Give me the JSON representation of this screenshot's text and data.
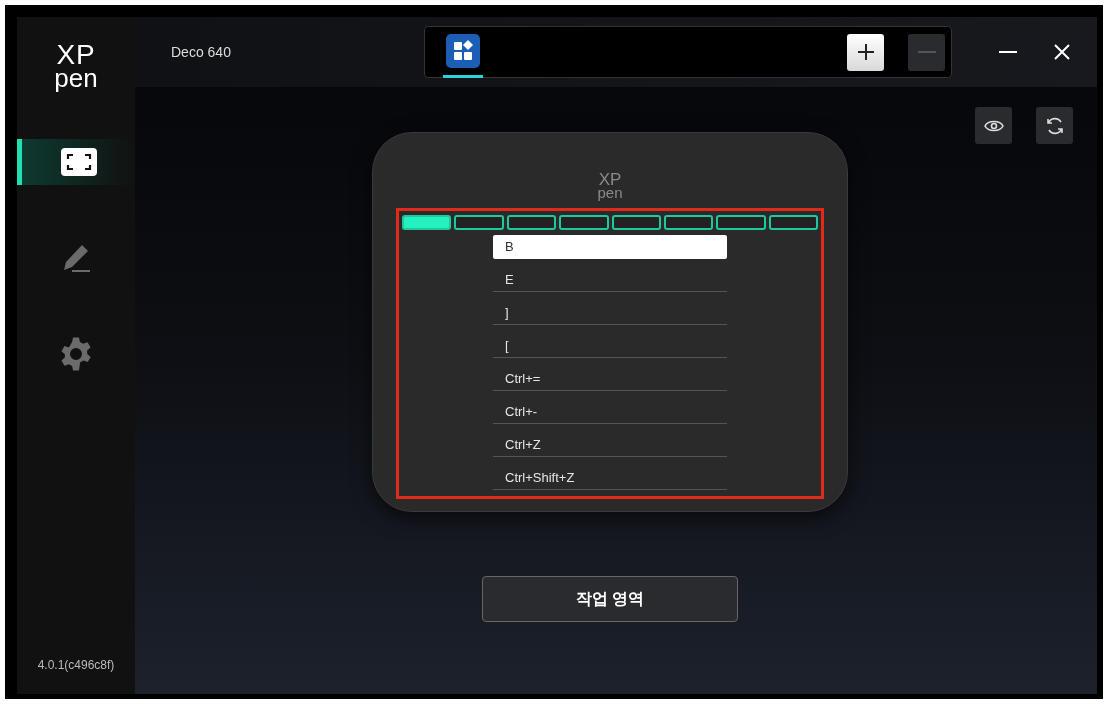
{
  "app": {
    "logo_top": "XP",
    "logo_bottom": "pen",
    "version": "4.0.1(c496c8f)"
  },
  "sidebar": {
    "items": [
      {
        "kind": "area",
        "selected": true
      },
      {
        "kind": "pen",
        "selected": false
      },
      {
        "kind": "settings",
        "selected": false
      }
    ]
  },
  "device": {
    "name": "Deco 640"
  },
  "profiles": [
    {
      "selected": true
    }
  ],
  "tablet": {
    "logo_top": "XP",
    "logo_bottom": "pen",
    "keys": [
      {
        "selected": true
      },
      {
        "selected": false
      },
      {
        "selected": false
      },
      {
        "selected": false
      },
      {
        "selected": false
      },
      {
        "selected": false
      },
      {
        "selected": false
      },
      {
        "selected": false
      }
    ],
    "shortcuts": [
      {
        "value": "B",
        "selected": true
      },
      {
        "value": "E",
        "selected": false
      },
      {
        "value": "]",
        "selected": false
      },
      {
        "value": "[",
        "selected": false
      },
      {
        "value": "Ctrl+=",
        "selected": false
      },
      {
        "value": "Ctrl+-",
        "selected": false
      },
      {
        "value": "Ctrl+Z",
        "selected": false
      },
      {
        "value": "Ctrl+Shift+Z",
        "selected": false
      }
    ]
  },
  "work_area_button": "작업 영역"
}
